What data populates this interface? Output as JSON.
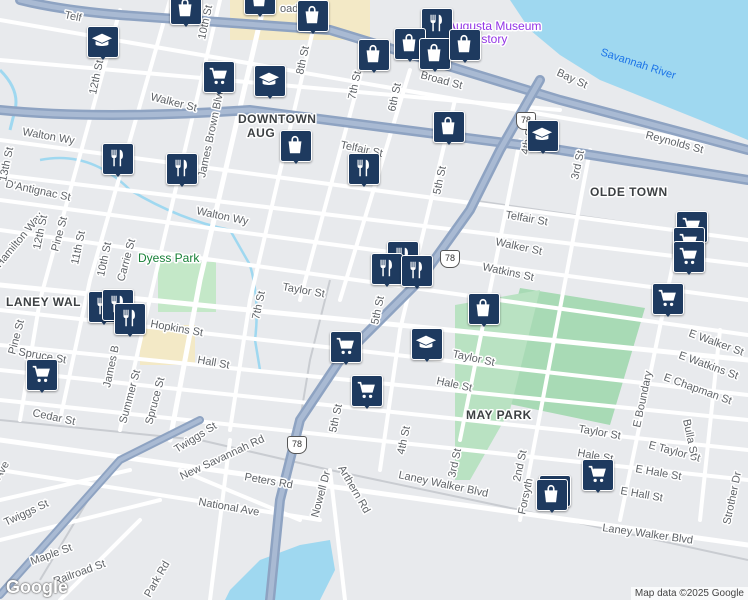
{
  "map": {
    "areas": {
      "downtown_line1": "DOWNTOWN",
      "downtown_line2": "AUG",
      "olde_town": "OLDE TOWN",
      "may_park": "MAY PARK",
      "laney_walker": "LANEY WAL"
    },
    "parks": {
      "dyess": "Dyess Park"
    },
    "water": {
      "savannah": "Savannah River"
    },
    "poi": {
      "museum_line1": "Augusta Museum",
      "museum_line2": "History"
    },
    "route_shield": "78",
    "streets": {
      "walker_nw": "Walker St",
      "walton_wy_1": "Walton Wy",
      "walton_wy_2": "Walton Wy",
      "dantignac": "D'Antignac St",
      "telfair_1": "Telfair St",
      "telfair_2": "Telfair St",
      "reynolds": "Reynolds St",
      "bay": "Bay St",
      "broad": "Broad St",
      "walker_e": "Walker St",
      "watkins": "Watkins St",
      "taylor_w": "Taylor St",
      "taylor_e": "Taylor St",
      "taylor_se": "Taylor St",
      "hopkins": "Hopkins St",
      "hall": "Hall St",
      "hale": "Hale St",
      "hale_se": "Hale St",
      "hall_e": "E Hall St",
      "hale_e": "E Hale St",
      "taylor_e2": "E Taylor St",
      "chapman": "E Chapman St",
      "watkins_e": "E Watkins St",
      "walker_e2": "E Walker St",
      "spruce_w": "Spruce St",
      "spruce_c": "Spruce St",
      "cedar": "Cedar St",
      "summer": "Summer St",
      "twiggs_1": "Twiggs St",
      "twiggs_2": "Twiggs St",
      "new_savannah": "New Savannah Rd",
      "peters": "Peters Rd",
      "national": "National Ave",
      "nowell": "Nowell Dr",
      "arthern": "Arthern Rd",
      "laney_walker_1": "Laney Walker Blvd",
      "laney_walker_2": "Laney Walker Blvd",
      "maple": "Maple St",
      "railroad": "Railroad St",
      "park_rd": "Park Rd",
      "ave": "Ave",
      "hamilton": "Hamilton Way",
      "pine_w": "Pine St",
      "pine_c": "Pine St",
      "carrie": "Carrie St",
      "james_brown_1": "James Brown Blvd",
      "james_brown_2": "James B",
      "st_12th": "12th St",
      "st_12th_b": "12th St",
      "st_11th": "11th St",
      "st_10th": "10th St",
      "st_10th_b": "10th St",
      "st_8th": "8th St",
      "st_7th": "7th St",
      "st_7th_b": "7th St",
      "st_6th": "6th St",
      "st_5th": "5th St",
      "st_5th_b": "5th St",
      "st_5th_c": "5th St",
      "st_4th": "4th St",
      "st_4th_b": "4th St",
      "st_3rd": "3rd St",
      "st_3rd_b": "3rd St",
      "st_2nd": "2nd St",
      "forsyth": "Forsyth",
      "e_boundary": "E Boundary",
      "bulla": "Bulla St",
      "strother": "Strother Dr",
      "st_13th": "13th St",
      "telf_nw": "Telf",
      "road_nw": "oad"
    }
  },
  "attribution": "Map data ©2025 Google",
  "logo": "Google",
  "colors": {
    "marker": "#1e3a5f",
    "park": "#c4e8c8",
    "park_dark": "#a8dab5",
    "water": "#9fd8f0",
    "highway": "#8ea3c2"
  }
}
